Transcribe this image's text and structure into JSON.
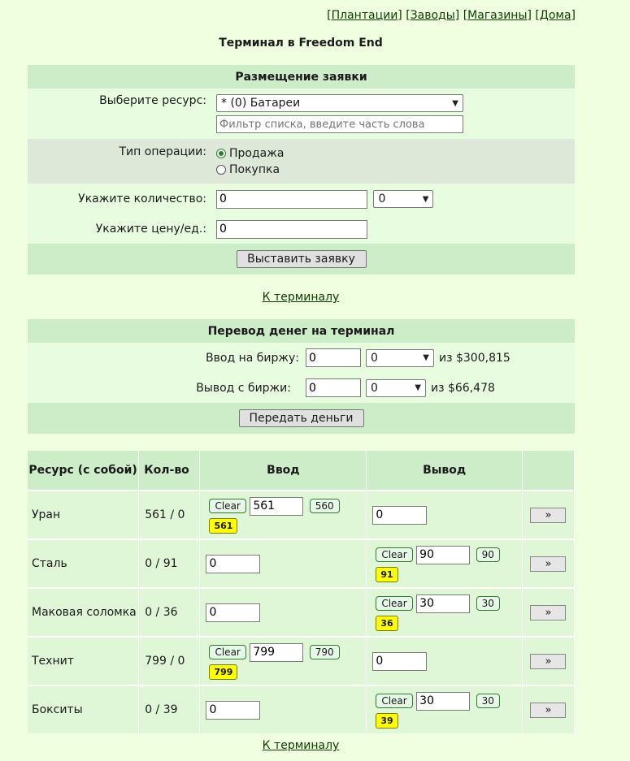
{
  "nav": {
    "links": [
      "Плантации",
      "Заводы",
      "Магазины",
      "Дома"
    ]
  },
  "page_title": "Терминал в Freedom End",
  "order": {
    "header": "Размещение заявки",
    "resource_label": "Выберите ресурс:",
    "resource_selected": "* (0) Батареи",
    "filter_placeholder": "Фильтр списка, введите часть слова",
    "operation_label": "Тип операции:",
    "op_sell": "Продажа",
    "op_buy": "Покупка",
    "qty_label": "Укажите количество:",
    "qty_value": "0",
    "qty_select": "0",
    "price_label": "Укажите цену/ед.:",
    "price_value": "0",
    "submit_label": "Выставить заявку"
  },
  "to_terminal_1": "К терминалу",
  "transfer": {
    "header": "Перевод денег на терминал",
    "in_label": "Ввод на биржу:",
    "in_value": "0",
    "in_select": "0",
    "in_of": "из $300,815",
    "out_label": "Вывод с биржи:",
    "out_value": "0",
    "out_select": "0",
    "out_of": "из $66,478",
    "submit_label": "Передать деньги"
  },
  "table": {
    "headers": [
      "Ресурс (с собой)",
      "Кол-во",
      "Ввод",
      "Вывод",
      ""
    ],
    "rows": [
      {
        "name": "Уран",
        "qty": "561 / 0",
        "in_mode": "clear",
        "in_clear": "Clear",
        "in_value": "561",
        "in_chip": "560",
        "in_yellow": "561",
        "out_mode": "plain",
        "out_value": "0",
        "go": "»"
      },
      {
        "name": "Сталь",
        "qty": "0 / 91",
        "in_mode": "plain",
        "in_value": "0",
        "out_mode": "clear",
        "out_clear": "Clear",
        "out_value": "90",
        "out_chip": "90",
        "out_yellow": "91",
        "go": "»"
      },
      {
        "name": "Маковая соломка",
        "qty": "0 / 36",
        "in_mode": "plain",
        "in_value": "0",
        "out_mode": "clear",
        "out_clear": "Clear",
        "out_value": "30",
        "out_chip": "30",
        "out_yellow": "36",
        "go": "»"
      },
      {
        "name": "Технит",
        "qty": "799 / 0",
        "in_mode": "clear",
        "in_clear": "Clear",
        "in_value": "799",
        "in_chip": "790",
        "in_yellow": "799",
        "out_mode": "plain",
        "out_value": "0",
        "go": "»"
      },
      {
        "name": "Бокситы",
        "qty": "0 / 39",
        "in_mode": "plain",
        "in_value": "0",
        "out_mode": "clear",
        "out_clear": "Clear",
        "out_value": "30",
        "out_chip": "30",
        "out_yellow": "39",
        "go": "»"
      }
    ]
  },
  "to_terminal_2": "К терминалу"
}
